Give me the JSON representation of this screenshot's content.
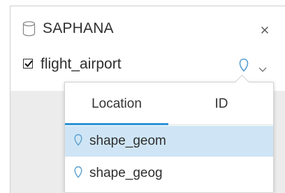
{
  "panel": {
    "title": "SAPHANA",
    "title_icon": "database-icon",
    "close_icon": "close-icon"
  },
  "dataset": {
    "label": "flight_airport",
    "checked": true,
    "location_icon": "location-pin-icon",
    "menu_icon": "chevron-down-icon"
  },
  "dropdown": {
    "tabs": [
      {
        "label": "Location",
        "active": true
      },
      {
        "label": "ID",
        "active": false
      }
    ],
    "fields": [
      {
        "label": "shape_geom",
        "icon": "location-pin-icon",
        "selected": true
      },
      {
        "label": "shape_geog",
        "icon": "location-pin-icon",
        "selected": false
      }
    ]
  },
  "colors": {
    "accent": "#2d93d6",
    "selected_bg": "#cfe5f5",
    "panel_bg_lower": "#ececec",
    "icon": "#5a9fd0"
  }
}
